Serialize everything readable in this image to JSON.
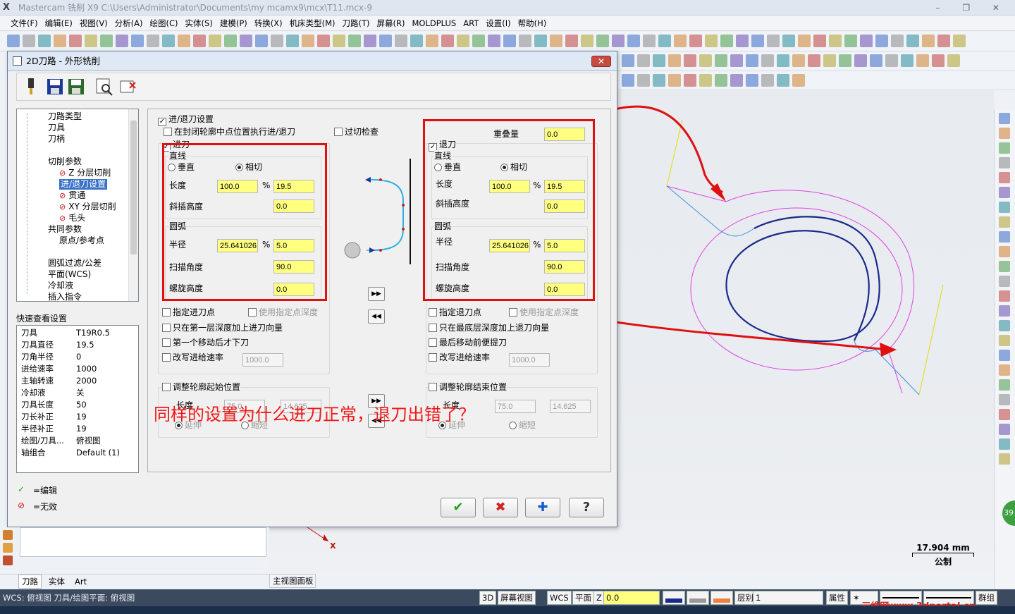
{
  "app": {
    "title": "Mastercam 铣削 X9  C:\\Users\\Administrator\\Documents\\my mcamx9\\mcx\\T11.mcx-9",
    "window_controls": "–  ❐  ✕"
  },
  "menu": [
    "文件(F)",
    "编辑(E)",
    "视图(V)",
    "分析(A)",
    "绘图(C)",
    "实体(S)",
    "建模(P)",
    "转换(X)",
    "机床类型(M)",
    "刀路(T)",
    "屏幕(R)",
    "MOLDPLUS",
    "ART",
    "设置(I)",
    "帮助(H)"
  ],
  "dialog": {
    "title": "2D刀路 - 外形铣削",
    "close": "✕",
    "tree": [
      {
        "label": "刀路类型",
        "indent": 0
      },
      {
        "label": "刀具",
        "indent": 0
      },
      {
        "label": "刀柄",
        "indent": 0
      },
      {
        "label": "切削参数",
        "indent": 0
      },
      {
        "label": "Z 分层切削",
        "indent": 1,
        "invalid": true
      },
      {
        "label": "进/退刀设置",
        "indent": 1,
        "selected": true
      },
      {
        "label": "贯通",
        "indent": 1,
        "invalid": true
      },
      {
        "label": "XY 分层切削",
        "indent": 1,
        "invalid": true
      },
      {
        "label": "毛头",
        "indent": 1,
        "invalid": true
      },
      {
        "label": "共同参数",
        "indent": 0
      },
      {
        "label": "原点/参考点",
        "indent": 1
      },
      {
        "label": "圆弧过滤/公差",
        "indent": 0
      },
      {
        "label": "平面(WCS)",
        "indent": 0
      },
      {
        "label": "冷却液",
        "indent": 0
      },
      {
        "label": "插入指令",
        "indent": 0
      }
    ],
    "quick": {
      "title": "快速查看设置",
      "rows": [
        {
          "k": "刀具",
          "v": "T19R0.5"
        },
        {
          "k": "刀具直径",
          "v": "19.5"
        },
        {
          "k": "刀角半径",
          "v": "0"
        },
        {
          "k": "进给速率",
          "v": "1000"
        },
        {
          "k": "主轴转速",
          "v": "2000"
        },
        {
          "k": "冷却液",
          "v": "关"
        },
        {
          "k": "刀具长度",
          "v": "50"
        },
        {
          "k": "刀长补正",
          "v": "19"
        },
        {
          "k": "半径补正",
          "v": "19"
        },
        {
          "k": "绘图/刀具...",
          "v": "俯视图"
        },
        {
          "k": "轴组合",
          "v": "Default (1)"
        }
      ]
    },
    "legend": {
      "edit_icon": "✓",
      "edit": "=编辑",
      "invalid_icon": "⊘",
      "invalid": "=无效"
    },
    "panel": {
      "enable": "进/退刀设置",
      "midpoint": "在封闭轮廓中点位置执行进/退刀",
      "overcut": "过切检查",
      "overlap_label": "重叠量",
      "overlap": "0.0",
      "entry": {
        "title": "进刀",
        "line": "直线",
        "perp": "垂直",
        "tangent": "相切",
        "length": "长度",
        "length_pct": "100.0",
        "length_val": "19.5",
        "ramp": "斜插高度",
        "ramp_val": "0.0",
        "arc": "圆弧",
        "radius": "半径",
        "radius_pct": "25.641026",
        "radius_val": "5.0",
        "sweep": "扫描角度",
        "sweep_val": "90.0",
        "helix": "螺旋高度",
        "helix_val": "0.0",
        "pct": "%"
      },
      "exit": {
        "title": "退刀",
        "line": "直线",
        "perp": "垂直",
        "tangent": "相切",
        "length": "长度",
        "length_pct": "100.0",
        "length_val": "19.5",
        "ramp": "斜插高度",
        "ramp_val": "0.0",
        "arc": "圆弧",
        "radius": "半径",
        "radius_pct": "25.641026",
        "radius_val": "5.0",
        "sweep": "扫描角度",
        "sweep_val": "90.0",
        "helix": "螺旋高度",
        "helix_val": "0.0",
        "pct": "%"
      },
      "entry_opts": {
        "point": "指定进刀点",
        "use_depth": "使用指定点深度",
        "first_depth": "只在第一层深度加上进刀向量",
        "first_move": "第一个移动后才下刀",
        "override": "改写进给速率",
        "override_val": "1000.0"
      },
      "exit_opts": {
        "point": "指定退刀点",
        "use_depth": "使用指定点深度",
        "last_depth": "只在最底层深度加上退刀向量",
        "last_move": "最后移动前便提刀",
        "override": "改写进给速率",
        "override_val": "1000.0"
      },
      "adjust_start": {
        "title": "调整轮廓起始位置",
        "length": "长度",
        "pct": "75.0",
        "val": "14.625",
        "extend": "延伸",
        "shorten": "缩短"
      },
      "adjust_end": {
        "title": "调整轮廓结束位置",
        "length": "长度",
        "pct": "75.0",
        "val": "14.625",
        "extend": "延伸",
        "shorten": "缩短"
      },
      "copy_right": "▶▶",
      "copy_left": "◀◀"
    },
    "buttons": {
      "ok": "✔",
      "cancel": "✖",
      "apply": "✚",
      "help": "?"
    }
  },
  "annotation": "同样的设置为什么进刀正常，退刀出错了？",
  "viewport": {
    "scale_value": "17.904 mm",
    "scale_unit": "公制",
    "axis_x": "X"
  },
  "bottom": {
    "tabs": [
      "刀路",
      "实体",
      "Art"
    ],
    "view_tab": "主视图面板"
  },
  "status": {
    "wcs": "WCS: 俯视图  刀具/绘图平面: 俯视图",
    "3d": "3D",
    "screen_view": "屏幕视图",
    "wcs_btn": "WCS",
    "plane": "平面",
    "z": "Z",
    "z_val": "0.0",
    "level": "层别",
    "level_val": "1",
    "attr": "属性",
    "group": "群组"
  },
  "watermark": "三维网www.3dportal.cn",
  "badge": "39",
  "colors": {
    "input_yellow": "#ffff80",
    "highlight_red": "#e01010",
    "toolpath_blue": "#1a2a8a",
    "magenta": "#e040e0"
  }
}
